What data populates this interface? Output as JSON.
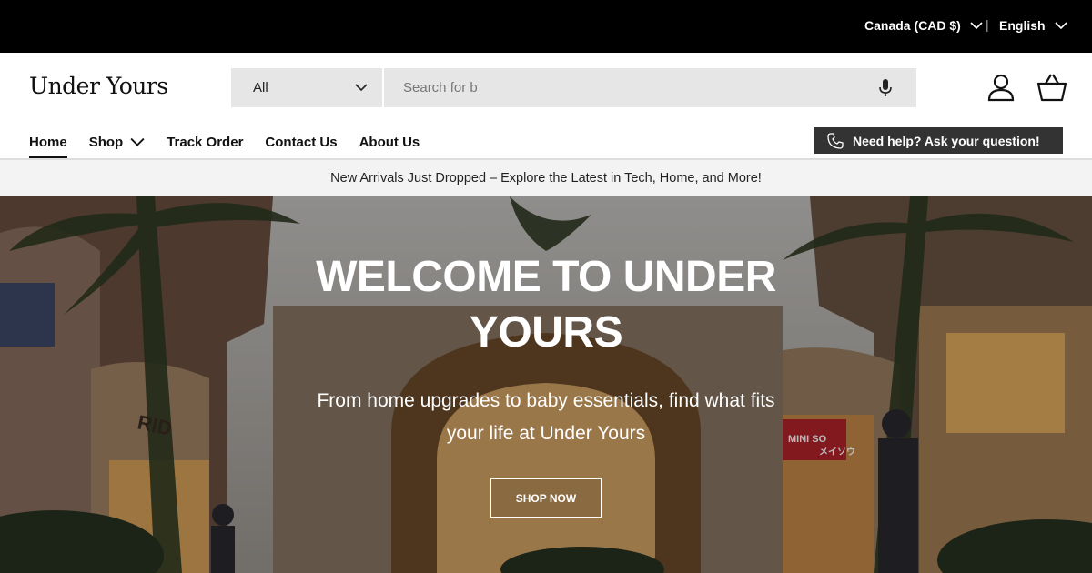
{
  "topbar": {
    "country": "Canada (CAD $)",
    "separator": "|",
    "language": "English"
  },
  "header": {
    "logo": "Under Yours",
    "search": {
      "category": "All",
      "placeholder": "Search for b"
    }
  },
  "nav": {
    "items": [
      {
        "label": "Home"
      },
      {
        "label": "Shop"
      },
      {
        "label": "Track Order"
      },
      {
        "label": "Contact Us"
      },
      {
        "label": "About Us"
      }
    ],
    "help_label": "Need help? Ask your question!"
  },
  "announcement": "New Arrivals Just Dropped – Explore the Latest in Tech, Home, and More!",
  "hero": {
    "title_line1": "WELCOME TO UNDER",
    "title_line2": "YOURS",
    "subtitle_line1": "From home upgrades to baby essentials, find what fits",
    "subtitle_line2": "your life at Under Yours",
    "button": "SHOP NOW",
    "image_signs": [
      "RID",
      "MINI SO",
      "メイソウ"
    ]
  }
}
